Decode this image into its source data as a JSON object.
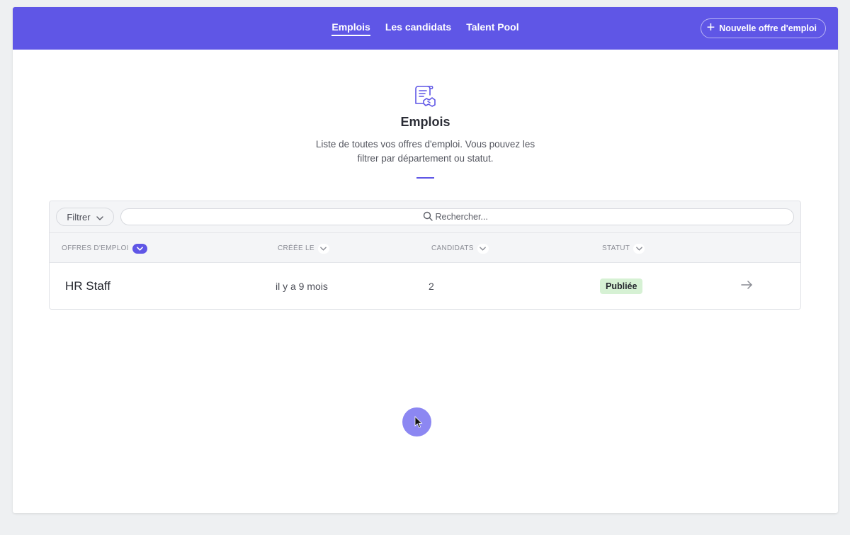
{
  "nav": {
    "items": [
      {
        "label": "Emplois",
        "active": true
      },
      {
        "label": "Les candidats",
        "active": false
      },
      {
        "label": "Talent Pool",
        "active": false
      }
    ],
    "new_job_label": "Nouvelle offre d'emploi"
  },
  "hero": {
    "icon": "job-listing-handshake-icon",
    "title": "Emplois",
    "description": "Liste de toutes vos offres d'emploi. Vous pouvez les filtrer par département ou statut."
  },
  "toolbar": {
    "filter_label": "Filtrer",
    "search_placeholder": "Rechercher..."
  },
  "table": {
    "columns": [
      "OFFRES D'EMPLOI",
      "CRÉÉE LE",
      "CANDIDATS",
      "STATUT"
    ],
    "rows": [
      {
        "title": "HR Staff",
        "created": "il y a 9 mois",
        "candidates": "2",
        "status": "Publiée"
      }
    ]
  },
  "colors": {
    "brand": "#5f56e6",
    "status_published_bg": "#d6f1d4"
  }
}
